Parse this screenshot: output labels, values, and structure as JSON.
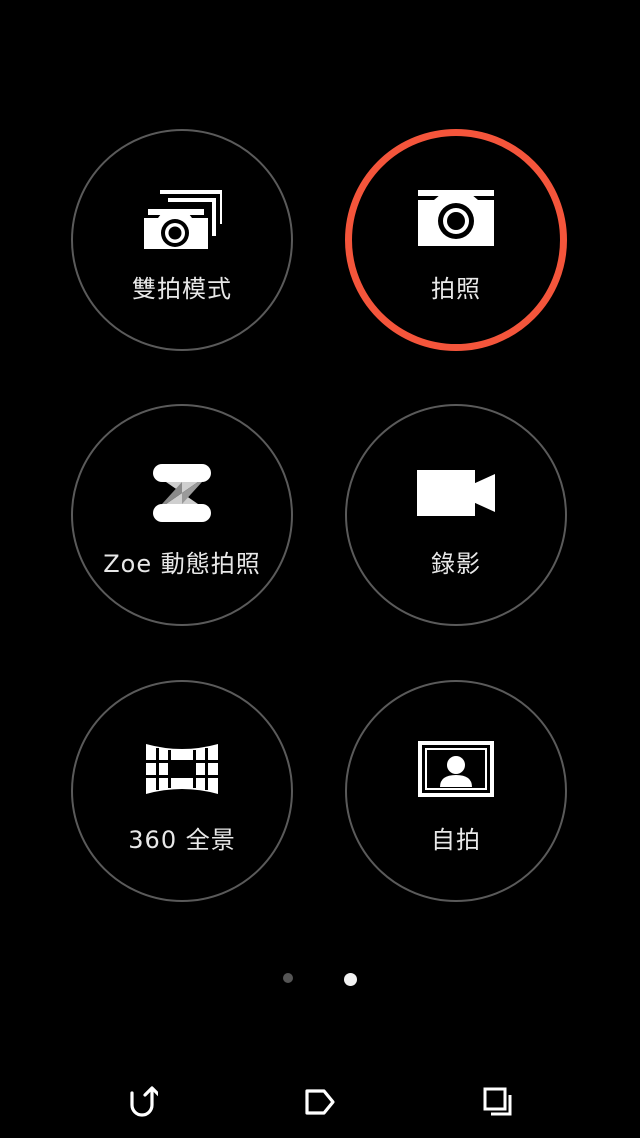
{
  "modes": [
    {
      "label": "雙拍模式",
      "icon": "dual-capture-icon",
      "selected": false
    },
    {
      "label": "拍照",
      "icon": "camera-icon",
      "selected": true
    },
    {
      "label": "Zoe 動態拍照",
      "icon": "zoe-icon",
      "selected": false
    },
    {
      "label": "錄影",
      "icon": "video-camera-icon",
      "selected": false
    },
    {
      "label": "360 全景",
      "icon": "panorama-icon",
      "selected": false
    },
    {
      "label": "自拍",
      "icon": "selfie-portrait-icon",
      "selected": false
    }
  ],
  "pager": {
    "page_count": 2,
    "current_page": 2
  },
  "navbar": {
    "back": "back-icon",
    "home": "home-icon",
    "recents": "recents-icon"
  },
  "colors": {
    "background": "#000000",
    "ring": "#5a5a5a",
    "selected_ring": "#f4553b",
    "text": "#e8e8e8"
  }
}
